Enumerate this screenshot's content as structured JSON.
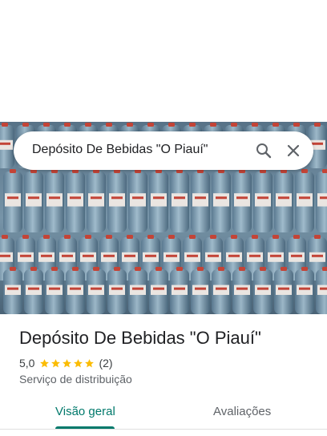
{
  "search": {
    "query": "Depósito De Bebidas \"O Piauí\""
  },
  "place": {
    "name": "Depósito De Bebidas \"O Piauí\"",
    "rating": "5,0",
    "stars": 5,
    "review_count": "(2)",
    "category": "Serviço de distribuição"
  },
  "tabs": [
    {
      "label": "Visão geral",
      "active": true
    },
    {
      "label": "Avaliações",
      "active": false
    }
  ],
  "colors": {
    "accent": "#00796b",
    "star": "#fbbc04",
    "text": "#202124",
    "muted": "#5f6368"
  },
  "icons": [
    "search-icon",
    "close-icon",
    "star-icon"
  ]
}
